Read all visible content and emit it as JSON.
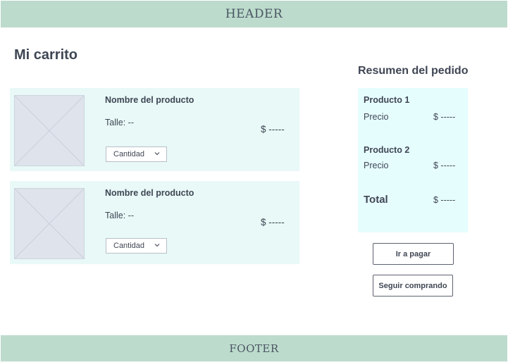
{
  "header": {
    "label": "HEADER"
  },
  "footer": {
    "label": "FOOTER"
  },
  "cart": {
    "title": "Mi carrito",
    "items": [
      {
        "name": "Nombre del producto",
        "size": "Talle: --",
        "price": "$ -----",
        "quantity_label": "Cantidad"
      },
      {
        "name": "Nombre del producto",
        "size": "Talle: --",
        "price": "$ -----",
        "quantity_label": "Cantidad"
      }
    ]
  },
  "summary": {
    "title": "Resumen del pedido",
    "products": [
      {
        "name": "Producto 1",
        "price_label": "Precio",
        "price": "$ -----"
      },
      {
        "name": "Producto 2",
        "price_label": "Precio",
        "price": "$ -----"
      }
    ],
    "total_label": "Total",
    "total_value": "$ -----"
  },
  "actions": {
    "pay_label": "Ir a pagar",
    "continue_label": "Seguir comprando"
  },
  "colors": {
    "header_footer_bg": "#bcdbcc",
    "cart_item_bg": "#e8f9f7",
    "summary_bg": "#e6fdfe",
    "text": "#3f4654"
  },
  "icons": {
    "image_placeholder": "image-placeholder-icon",
    "dropdown": "chevron-down-icon"
  }
}
